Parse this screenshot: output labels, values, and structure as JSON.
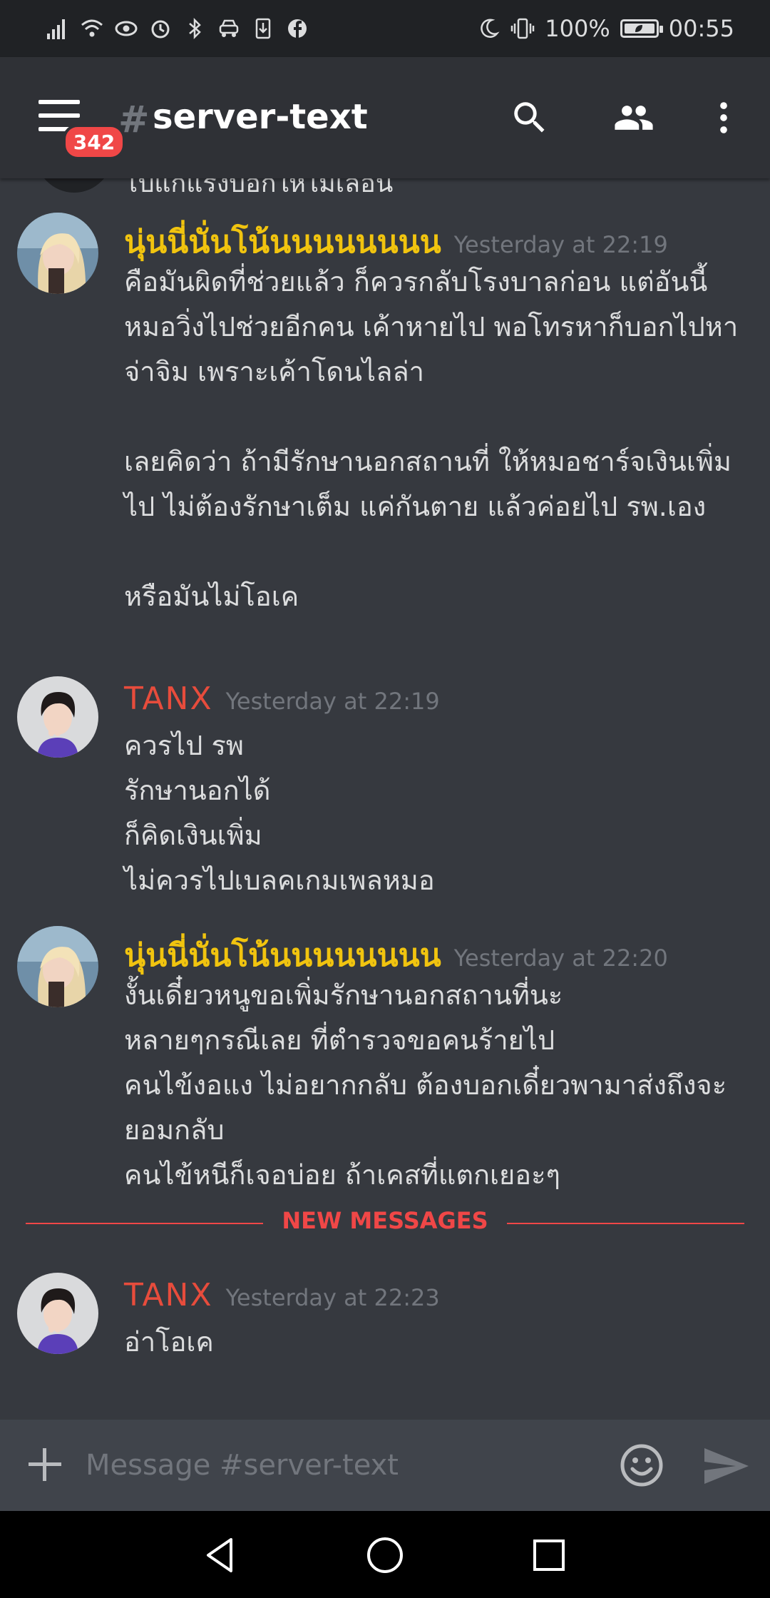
{
  "status_bar": {
    "battery_percent": "100%",
    "battery_level": 1.0,
    "time": "00:55",
    "left_icons": [
      "signal-icon",
      "wifi-icon",
      "eye-icon",
      "alarm-icon",
      "bluetooth-icon",
      "car-mode-icon",
      "download-icon",
      "facebook-icon"
    ],
    "right_icons": [
      "moon-icon",
      "vibrate-icon",
      "battery-icon"
    ]
  },
  "header": {
    "menu_badge": "342",
    "hash": "#",
    "channel_name": "server-text"
  },
  "messages": {
    "cut_text": "โปแก้แรงบอกให้ไม่เลื่อน",
    "items": [
      {
        "author": "นุ่นนี่นั่นโน้นนนนนนนน",
        "author_color": "#f1c40f",
        "timestamp": "Yesterday at 22:19",
        "text": "คือมันผิดที่ช่วยแล้ว ก็ควรกลับโรงบาลก่อน แต่อันนี้หมอวิ่งไปช่วยอีกคน เค้าหายไป พอโทรหาก็บอกไปหาจ่าจิม เพราะเค้าโดนไลล่า\n\nเลยคิดว่า ถ้ามีรักษานอกสถานที่ ให้หมอชาร์จเงินเพิ่มไป ไม่ต้องรักษาเต็ม แค่กันตาย แล้วค่อยไป รพ.เอง\n\nหรือมันไม่โอเค"
      },
      {
        "author": "TANX",
        "author_color": "#e74c3c",
        "timestamp": "Yesterday at 22:19",
        "text": "ควรไป รพ\nรักษานอกได้\nก็คิดเงินเพิ่ม\nไม่ควรไปเบลคเกมเพลหมอ"
      },
      {
        "author": "นุ่นนี่นั่นโน้นนนนนนนน",
        "author_color": "#f1c40f",
        "timestamp": "Yesterday at 22:20",
        "text": "งั้นเดี๋ยวหนูขอเพิ่มรักษานอกสถานที่นะ\nหลายๆกรณีเลย ที่ตำรวจขอคนร้ายไป\nคนไข้งอแง ไม่อยากกลับ ต้องบอกเดี๋ยวพามาส่งถึงจะยอมกลับ\nคนไข้หนีก็เจอบ่อย ถ้าเคสที่แตกเยอะๆ"
      },
      {
        "author": "TANX",
        "author_color": "#e74c3c",
        "timestamp": "Yesterday at 22:23",
        "text": "อ่าโอเค"
      }
    ],
    "divider_label": "NEW MESSAGES"
  },
  "composer": {
    "placeholder": "Message #server-text"
  },
  "nav": {
    "icons": [
      "back-icon",
      "home-icon",
      "recents-icon"
    ]
  }
}
